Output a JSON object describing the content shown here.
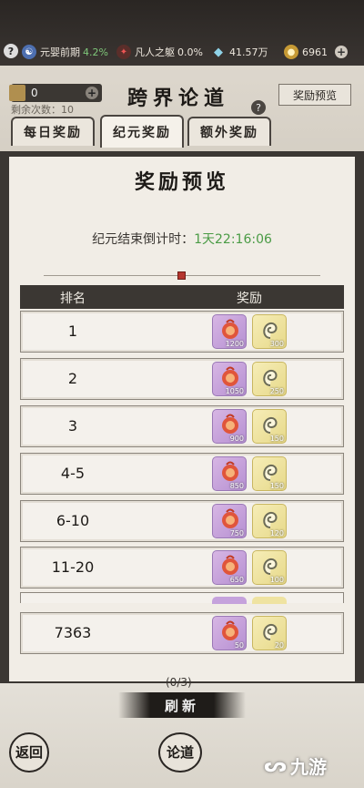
{
  "status_bar": {
    "help": "?",
    "realm": {
      "label": "元婴前期",
      "percent": "4.2%"
    },
    "body": {
      "label": "凡人之躯",
      "percent": "0.0%"
    },
    "spirit_stones": "41.57万",
    "currency": "6961",
    "plus": "+"
  },
  "header": {
    "counter_value": "0",
    "counter_plus": "+",
    "remaining": "剩余次数：10",
    "title": "跨界论道",
    "title_help": "?",
    "preview_button": "奖励预览",
    "tabs": [
      {
        "label": "每日奖励",
        "active": false
      },
      {
        "label": "纪元奖励",
        "active": true
      },
      {
        "label": "额外奖励",
        "active": false
      }
    ]
  },
  "modal": {
    "title": "奖励预览",
    "countdown_label": "纪元结束倒计时：",
    "countdown_time": "1天22:16:06",
    "col_rank": "排名",
    "col_reward": "奖励",
    "rows": [
      {
        "rank": "1",
        "qty_a": "1200",
        "qty_b": "300"
      },
      {
        "rank": "2",
        "qty_a": "1050",
        "qty_b": "250"
      },
      {
        "rank": "3",
        "qty_a": "900",
        "qty_b": "150"
      },
      {
        "rank": "4-5",
        "qty_a": "850",
        "qty_b": "150"
      },
      {
        "rank": "6-10",
        "qty_a": "750",
        "qty_b": "120"
      },
      {
        "rank": "11-20",
        "qty_a": "650",
        "qty_b": "100"
      }
    ],
    "self_row": {
      "rank": "7363",
      "qty_a": "50",
      "qty_b": "20"
    }
  },
  "bottom": {
    "progress": "(0/3)",
    "refresh": "刷新",
    "back": "返回",
    "debate": "论道"
  },
  "watermark": "九游",
  "colors": {
    "accent_green": "#4a9b45",
    "dark_panel": "#3b3733",
    "item_purple": "#c5a2dc",
    "item_yellow": "#efe3a1"
  },
  "icons": [
    "help-icon",
    "realm-icon",
    "body-icon",
    "spirit-stone-icon",
    "gold-coin-icon",
    "fire-fruit-icon",
    "spiral-shell-icon"
  ]
}
